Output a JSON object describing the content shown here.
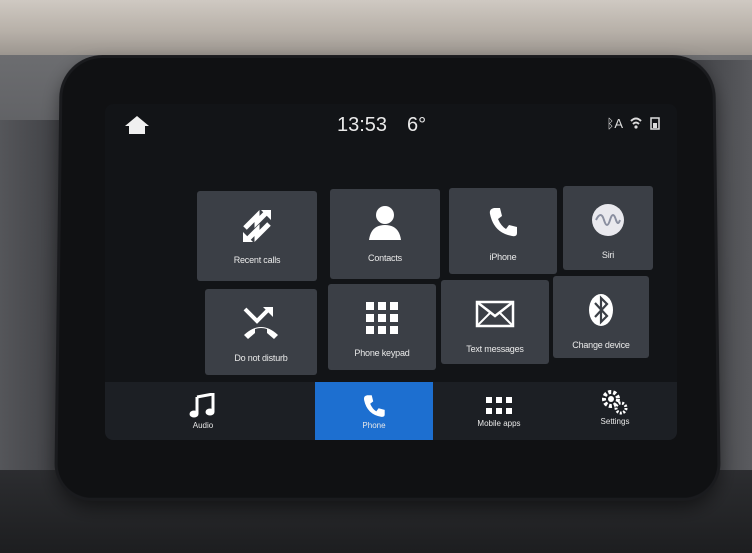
{
  "status_bar": {
    "time": "13:53",
    "temperature": "6°",
    "home_icon": "home-icon",
    "indicators": [
      "BT",
      "signal",
      "battery"
    ]
  },
  "tiles": [
    {
      "label": "Recent calls",
      "icon": "recent-calls-icon"
    },
    {
      "label": "Contacts",
      "icon": "contact-icon"
    },
    {
      "label": "iPhone",
      "icon": "phone-icon"
    },
    {
      "label": "Siri",
      "icon": "siri-icon"
    },
    {
      "label": "Do not disturb",
      "icon": "do-not-disturb-icon"
    },
    {
      "label": "Phone keypad",
      "icon": "keypad-icon"
    },
    {
      "label": "Text messages",
      "icon": "envelope-icon"
    },
    {
      "label": "Change device",
      "icon": "bluetooth-icon"
    }
  ],
  "nav": [
    {
      "label": "Audio",
      "icon": "music-note-icon",
      "active": false
    },
    {
      "label": "Phone",
      "icon": "phone-icon",
      "active": true
    },
    {
      "label": "Mobile apps",
      "icon": "apps-grid-icon",
      "active": false
    },
    {
      "label": "Settings",
      "icon": "gear-icon",
      "active": false
    }
  ],
  "colors": {
    "accent": "#1d6fd0",
    "tile": "#3b3f46"
  }
}
